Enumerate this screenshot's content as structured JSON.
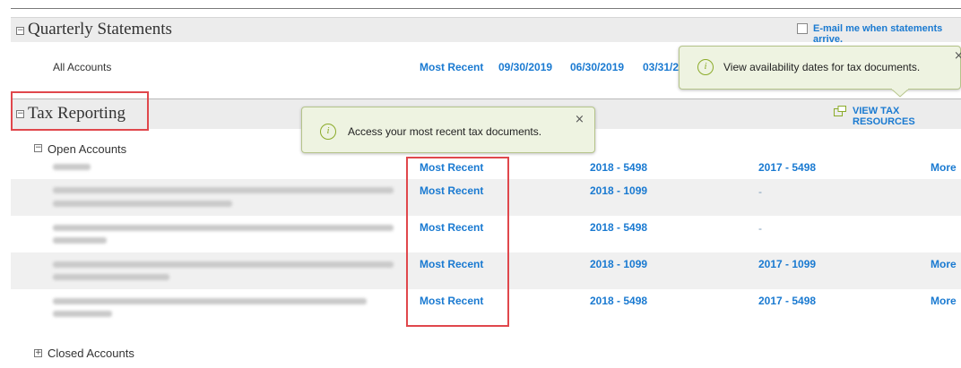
{
  "quarterly": {
    "title": "Quarterly Statements",
    "email_label": "E-mail me when statements arrive.",
    "all_accounts": "All Accounts",
    "links": [
      "Most Recent",
      "09/30/2019",
      "06/30/2019",
      "03/31/2019"
    ]
  },
  "tooltip_tax_dates": {
    "text": "View availability dates for tax documents.",
    "close": "×"
  },
  "tax": {
    "title": "Tax Reporting",
    "resources_label": "VIEW TAX RESOURCES",
    "open_label": "Open Accounts",
    "closed_label": "Closed Accounts",
    "rows": [
      {
        "most_recent": "Most Recent",
        "col2": "2018 - 5498",
        "col3": "2017 - 5498",
        "more": "More"
      },
      {
        "most_recent": "Most Recent",
        "col2": "2018 - 1099",
        "col3": "-",
        "more": ""
      },
      {
        "most_recent": "Most Recent",
        "col2": "2018 - 5498",
        "col3": "-",
        "more": ""
      },
      {
        "most_recent": "Most Recent",
        "col2": "2018 - 1099",
        "col3": "2017 - 1099",
        "more": "More"
      },
      {
        "most_recent": "Most Recent",
        "col2": "2018 - 5498",
        "col3": "2017 - 5498",
        "more": "More"
      }
    ]
  },
  "tooltip_recent": {
    "text": "Access your most recent tax documents.",
    "close": "×"
  },
  "colors": {
    "link": "#1a7ad1",
    "highlight": "#e0474c",
    "tooltip_bg": "#eef3e1",
    "tooltip_icon": "#8bab2a"
  }
}
